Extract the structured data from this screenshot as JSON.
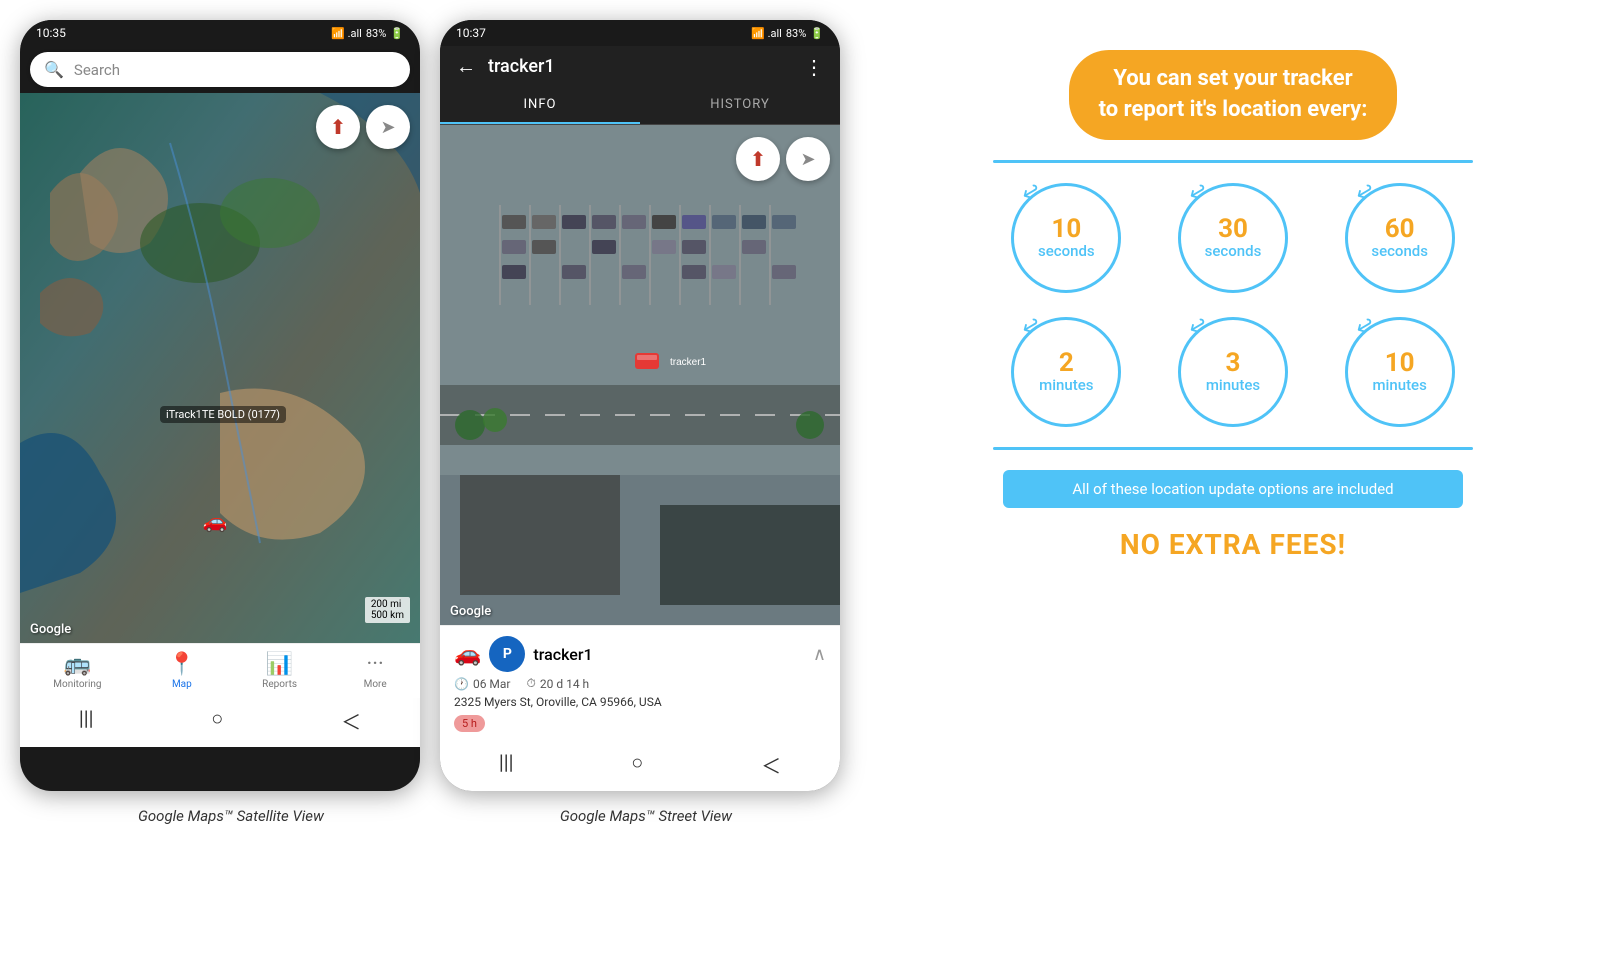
{
  "phone1": {
    "status_bar": {
      "time": "10:35",
      "signal": "📶",
      "network": ".all",
      "battery": "83%"
    },
    "search": {
      "placeholder": "Search"
    },
    "compass_icon": "⬆",
    "navigate_icon": "➤",
    "tracker_label": "iTrack1TE BOLD (0177)",
    "google_watermark": "Google",
    "scale_200mi": "200 mi",
    "scale_500km": "500 km",
    "nav_items": [
      {
        "label": "Monitoring",
        "icon": "🚌",
        "active": false
      },
      {
        "label": "Map",
        "icon": "📍",
        "active": true
      },
      {
        "label": "Reports",
        "icon": "📊",
        "active": false
      },
      {
        "label": "More",
        "icon": "···",
        "active": false
      }
    ],
    "nav_pills": [
      "|||",
      "○",
      "<"
    ],
    "caption": "Google Maps™ Satellite View"
  },
  "phone2": {
    "status_bar": {
      "time": "10:37",
      "battery": "83%"
    },
    "header": {
      "back": "←",
      "title": "tracker1",
      "more": "⋮"
    },
    "tabs": [
      {
        "label": "INFO",
        "active": true
      },
      {
        "label": "HISTORY",
        "active": false
      }
    ],
    "google_watermark": "Google",
    "tracker_info": {
      "avatar_letter": "P",
      "car_icon": "🚗",
      "name": "tracker1",
      "date": "06 Mar",
      "duration": "20 d 14 h",
      "address": "2325 Myers St, Oroville, CA 95966, USA",
      "badge": "5 h"
    },
    "compass_icon": "⬆",
    "nav_pills": [
      "|||",
      "○",
      "<"
    ],
    "caption": "Google Maps™ Street View"
  },
  "infographic": {
    "headline": "You can set your tracker\nto report it's location every:",
    "circles": [
      {
        "number": "10",
        "unit": "seconds"
      },
      {
        "number": "30",
        "unit": "seconds"
      },
      {
        "number": "60",
        "unit": "seconds"
      },
      {
        "number": "2",
        "unit": "minutes"
      },
      {
        "number": "3",
        "unit": "minutes"
      },
      {
        "number": "10",
        "unit": "minutes"
      }
    ],
    "included_text": "All of these location update options are included",
    "no_fees": "NO EXTRA FEES!",
    "colors": {
      "orange": "#f5a623",
      "blue": "#4fc3f7"
    }
  }
}
